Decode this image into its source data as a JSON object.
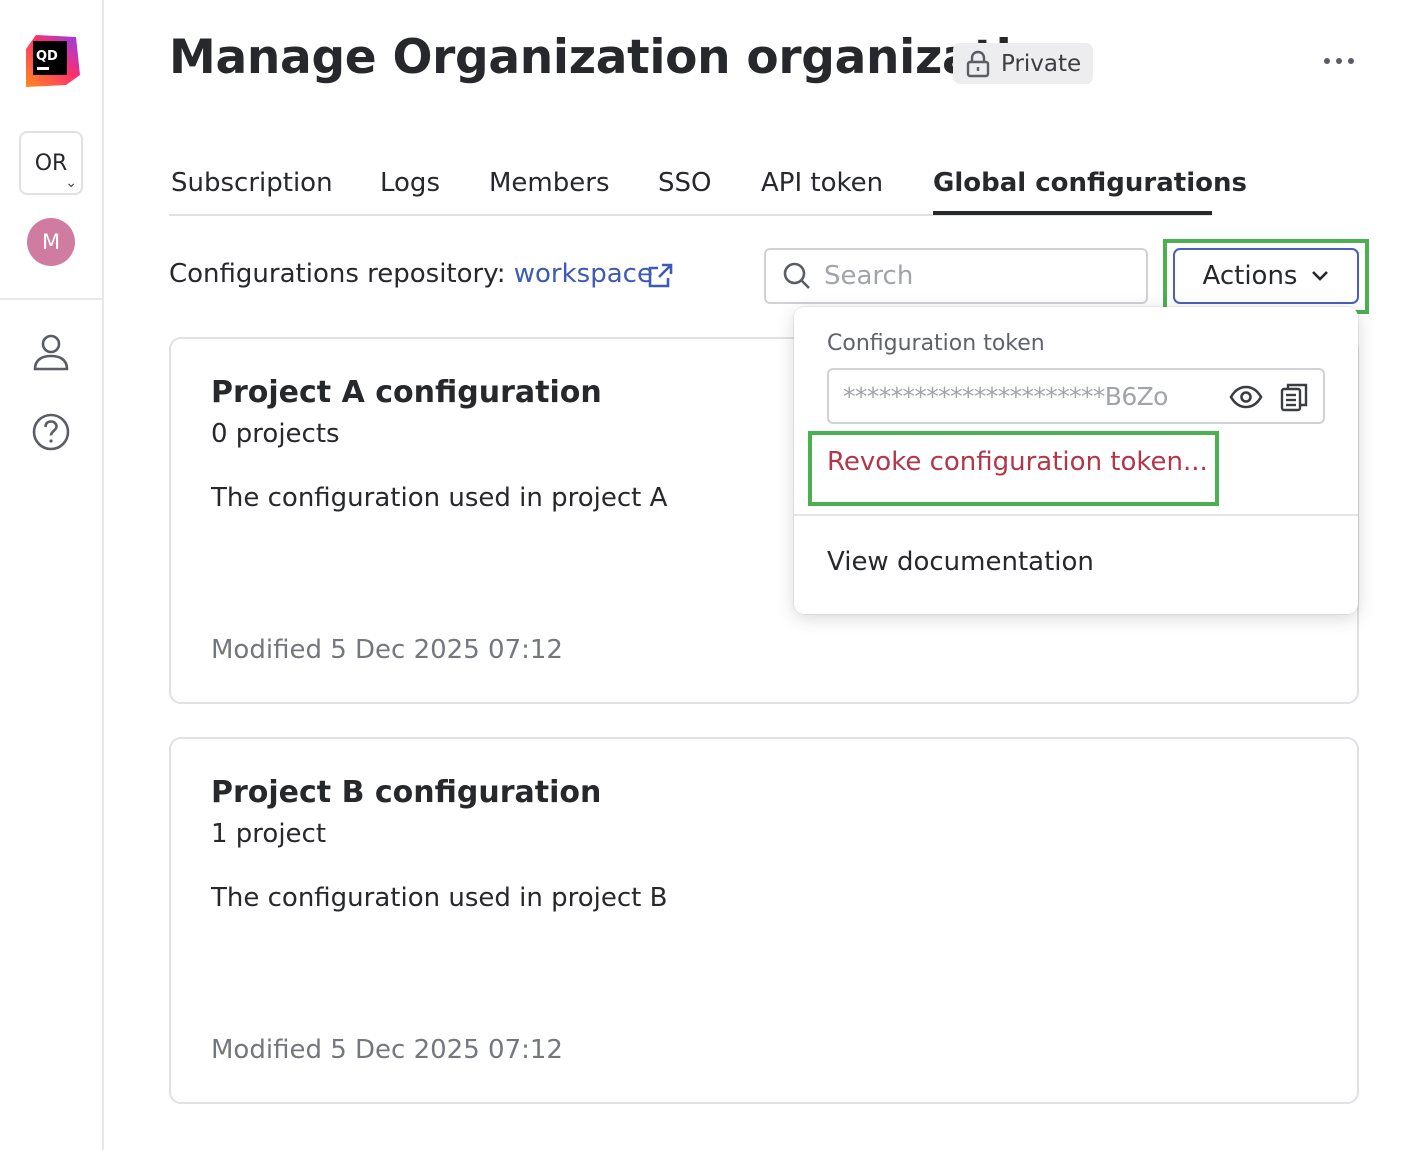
{
  "app": {
    "logo_text": "QD",
    "org_short": "OR",
    "user_initial": "M"
  },
  "header": {
    "title": "Manage Organization organization",
    "visibility_badge": "Private"
  },
  "tabs": [
    {
      "label": "Subscription",
      "active": false
    },
    {
      "label": "Logs",
      "active": false
    },
    {
      "label": "Members",
      "active": false
    },
    {
      "label": "SSO",
      "active": false
    },
    {
      "label": "API token",
      "active": false
    },
    {
      "label": "Global configurations",
      "active": true
    }
  ],
  "toolbar": {
    "repo_prefix": "Configurations repository: ",
    "repo_link": "workspace",
    "search_placeholder": "Search",
    "actions_label": "Actions"
  },
  "actions_menu": {
    "token_label": "Configuration token",
    "token_value": "**********************B6Zo",
    "revoke_label": "Revoke configuration token...",
    "docs_label": "View documentation"
  },
  "configurations": [
    {
      "title": "Project A configuration",
      "count": "0 projects",
      "description": "The configuration used in project A",
      "modified": "Modified 5 Dec 2025 07:12"
    },
    {
      "title": "Project B configuration",
      "count": "1 project",
      "description": "The configuration used in project B",
      "modified": "Modified 5 Dec 2025 07:12"
    }
  ],
  "colors": {
    "accent": "#3d5ab4",
    "danger": "#b3364a",
    "highlight": "#4caf50",
    "avatar": "#d07ba0"
  }
}
